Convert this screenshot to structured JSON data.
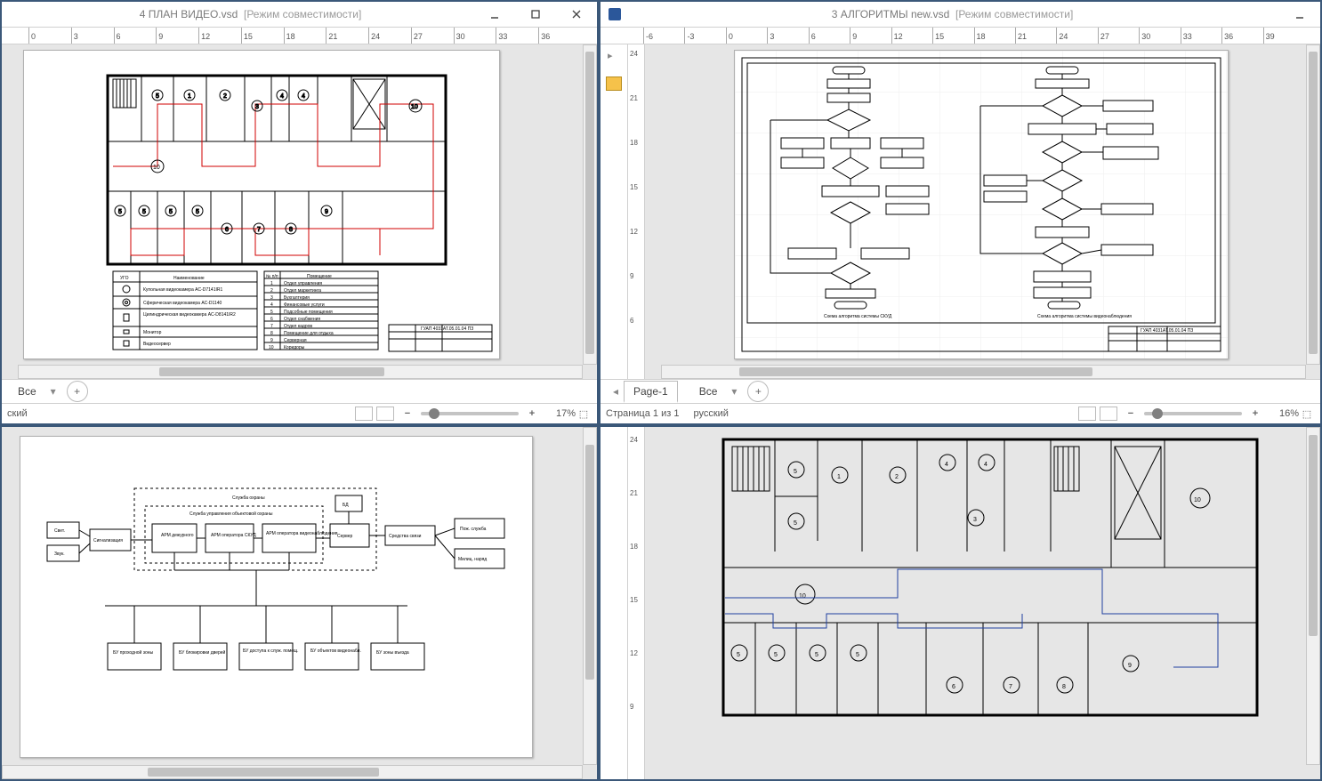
{
  "panes": {
    "tl": {
      "title_doc": "4 ПЛАН ВИДЕО.vsd",
      "title_mode": "[Режим совместимости]",
      "ruler_h": [
        "0",
        "3",
        "6",
        "9",
        "12",
        "15",
        "18",
        "21",
        "24",
        "27",
        "30",
        "33",
        "36"
      ],
      "zoom": "17%",
      "status_text": "ский",
      "sheet_label": "Все",
      "legend_left": {
        "col1": "УГО",
        "col2": "Наименование",
        "rows": [
          "Купольная видеокамера AC-D7141IR1",
          "Сферическая видеокамера AC-D1140",
          "Цилиндрическая видеокамера AC-D8141IR2",
          "Монитор",
          "Видеосервер"
        ]
      },
      "legend_right": {
        "col1": "№ п/п",
        "col2": "Помещение",
        "rows": [
          {
            "n": "1",
            "t": "Отдел управления"
          },
          {
            "n": "2",
            "t": "Отдел маркетинга"
          },
          {
            "n": "3",
            "t": "Бухгалтерия"
          },
          {
            "n": "4",
            "t": "Финансовые услуги"
          },
          {
            "n": "5",
            "t": "Подсобные помещения"
          },
          {
            "n": "6",
            "t": "Отдел снабжения"
          },
          {
            "n": "7",
            "t": "Отдел кадров"
          },
          {
            "n": "8",
            "t": "Помещение для отдыха"
          },
          {
            "n": "9",
            "t": "Серверная"
          },
          {
            "n": "10",
            "t": "Коридоры"
          }
        ]
      },
      "stamp": "ГУАП 4031АТ.05.01.04 ПЗ"
    },
    "tr": {
      "title_doc": "3 АЛГОРИТМЫ new.vsd",
      "title_mode": "[Режим совместимости]",
      "ruler_h": [
        "-6",
        "-3",
        "0",
        "3",
        "6",
        "9",
        "12",
        "15",
        "18",
        "21",
        "24",
        "27",
        "30",
        "33",
        "36",
        "39"
      ],
      "ruler_v": [
        "24",
        "21",
        "18",
        "15",
        "12",
        "9",
        "6"
      ],
      "page_tab": "Page-1",
      "sheet_label": "Все",
      "status_page": "Страница 1 из 1",
      "status_lang": "русский",
      "zoom": "16%",
      "caption_left": "Схема алгоритма системы СКУД",
      "caption_right": "Схема алгоритма системы видеонаблюдения",
      "stamp": "ГУАП 4031АТ.05.01.04 ПЗ"
    },
    "bl": {
      "header": "Служба охраны",
      "subheader": "Служба управления объектовой охраны",
      "boxes": {
        "svet": "Свет.",
        "zvuk": "Звук.",
        "signal": "Сигнализация",
        "arm1": "АРМ дежурного",
        "arm2": "АРМ оператора СКУД",
        "arm3": "АРМ оператора видеонаблюдения",
        "server": "Сервер",
        "bd": "БД",
        "comm": "Средства связи",
        "fire": "Пож. служба",
        "mil": "Милиц. наряд",
        "bu1": "БУ проходной зоны",
        "bu2": "БУ блокировки дверей",
        "bu3": "БУ доступа к служ. помещ.",
        "bu4": "БУ объектов видеонабл.",
        "bu5": "БУ зоны въезда"
      }
    },
    "br": {
      "ruler_v": [
        "24",
        "21",
        "18",
        "15",
        "12",
        "9"
      ],
      "rooms": {
        "r1": "1",
        "r2": "2",
        "r3": "3",
        "r4": "4",
        "r4b": "4",
        "r5a": "5",
        "r5b": "5",
        "r5c": "5",
        "r5d": "5",
        "r5e": "5",
        "r5f": "5",
        "r6": "6",
        "r7": "7",
        "r8": "8",
        "r9": "9",
        "r10a": "10",
        "r10b": "10"
      }
    }
  }
}
